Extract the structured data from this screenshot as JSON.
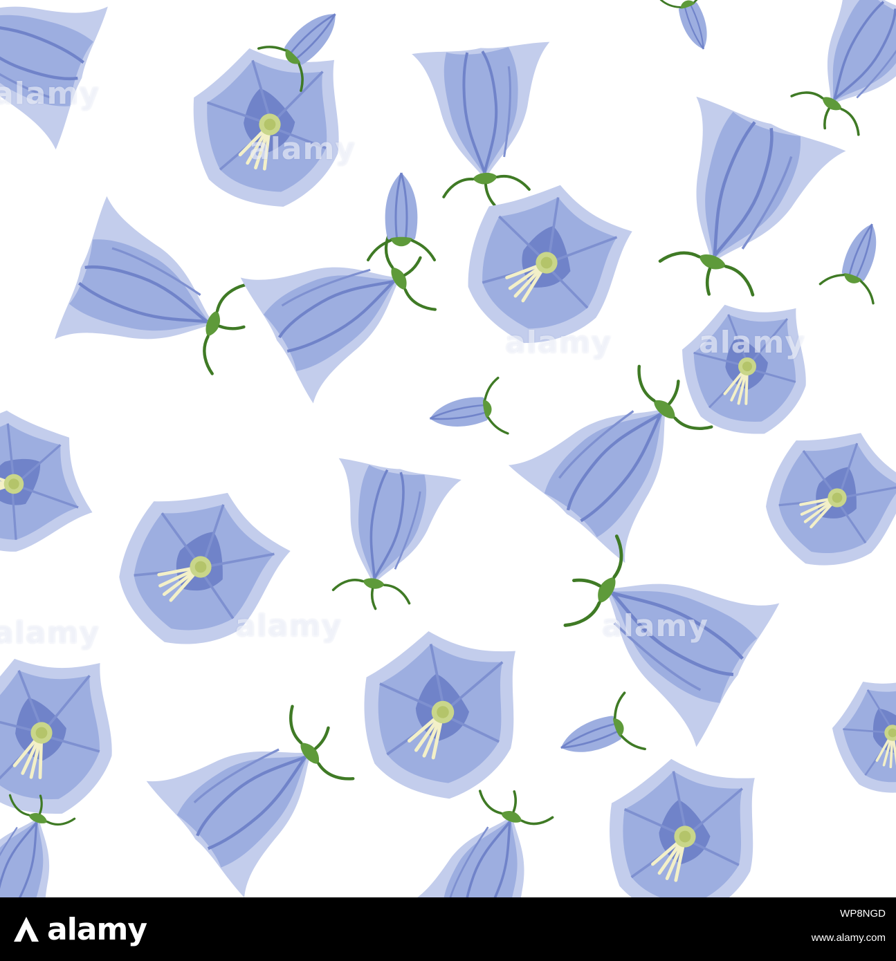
{
  "image": {
    "subject": "seamless pattern",
    "background_color": "#ffffff",
    "colors": {
      "petal_light": "#c3cdec",
      "petal_mid": "#9daee0",
      "petal_dark": "#7083c9",
      "petal_deep": "#5a6cb8",
      "sepal_green": "#5e9a3a",
      "sepal_dark": "#3f7a25",
      "stamen": "#f3f0c8",
      "pistil": "#c9d68a"
    },
    "watermark_text": "alamy"
  },
  "footer": {
    "logo_text": "alamy",
    "image_id": "WP8NGD",
    "site": "www.alamy.com",
    "background_color": "#000000"
  }
}
